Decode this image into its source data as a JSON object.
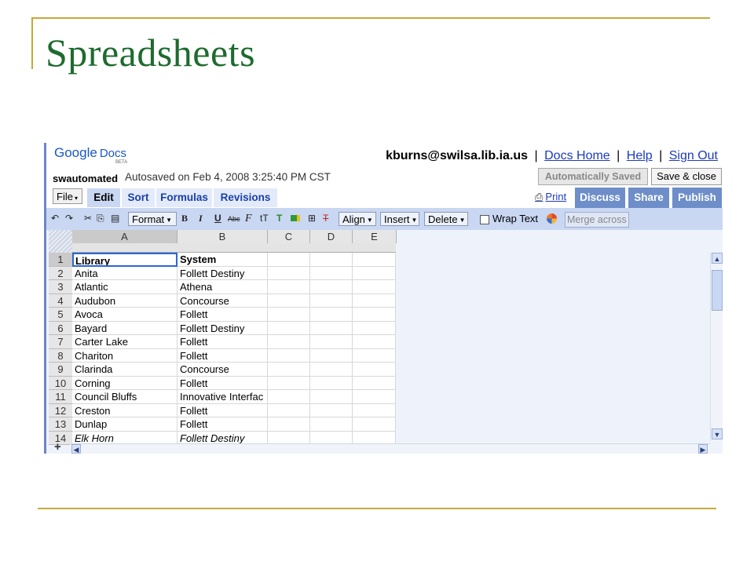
{
  "slide": {
    "title": "Spreadsheets"
  },
  "app": {
    "logo_google": "Google",
    "logo_docs": "Docs",
    "logo_beta": "BETA",
    "user_email": "kburns@swilsa.lib.ia.us",
    "links": {
      "docs_home": "Docs Home",
      "help": "Help",
      "sign_out": "Sign Out"
    },
    "separator": "|",
    "doc_name": "swautomated",
    "autosave_text": "Autosaved on Feb 4, 2008 3:25:40 PM CST",
    "buttons": {
      "auto_saved": "Automatically Saved",
      "save_close": "Save & close"
    }
  },
  "menu": {
    "file": "File",
    "tabs": [
      "Edit",
      "Sort",
      "Formulas",
      "Revisions"
    ],
    "print": "Print",
    "right_tabs": [
      "Discuss",
      "Share",
      "Publish"
    ]
  },
  "toolbar": {
    "format": "Format",
    "bold": "B",
    "italic": "I",
    "underline": "U",
    "strike": "Abc",
    "font": "F",
    "size": "tT",
    "align": "Align",
    "insert": "Insert",
    "delete": "Delete",
    "wrap_text": "Wrap Text",
    "merge_across": "Merge across"
  },
  "grid": {
    "columns": [
      "A",
      "B",
      "C",
      "D",
      "E"
    ],
    "rows": [
      {
        "n": "1",
        "a": "Library",
        "b": "System"
      },
      {
        "n": "2",
        "a": "Anita",
        "b": "Follett Destiny"
      },
      {
        "n": "3",
        "a": "Atlantic",
        "b": "Athena"
      },
      {
        "n": "4",
        "a": "Audubon",
        "b": "Concourse"
      },
      {
        "n": "5",
        "a": "Avoca",
        "b": "Follett"
      },
      {
        "n": "6",
        "a": "Bayard",
        "b": "Follett Destiny"
      },
      {
        "n": "7",
        "a": "Carter Lake",
        "b": "Follett"
      },
      {
        "n": "8",
        "a": "Chariton",
        "b": "Follett"
      },
      {
        "n": "9",
        "a": "Clarinda",
        "b": "Concourse"
      },
      {
        "n": "10",
        "a": "Corning",
        "b": "Follett"
      },
      {
        "n": "11",
        "a": "Council Bluffs",
        "b": "Innovative Interfac"
      },
      {
        "n": "12",
        "a": "Creston",
        "b": "Follett"
      },
      {
        "n": "13",
        "a": "Dunlap",
        "b": "Follett"
      },
      {
        "n": "14",
        "a": "Elk Horn",
        "b": "Follett Destiny"
      }
    ],
    "add_sheet": "+"
  },
  "colors": {
    "slide_accent": "#c8a83a",
    "title": "#1e6b2f",
    "tab_blue": "#6d8ec8",
    "link": "#1c3cbd"
  }
}
